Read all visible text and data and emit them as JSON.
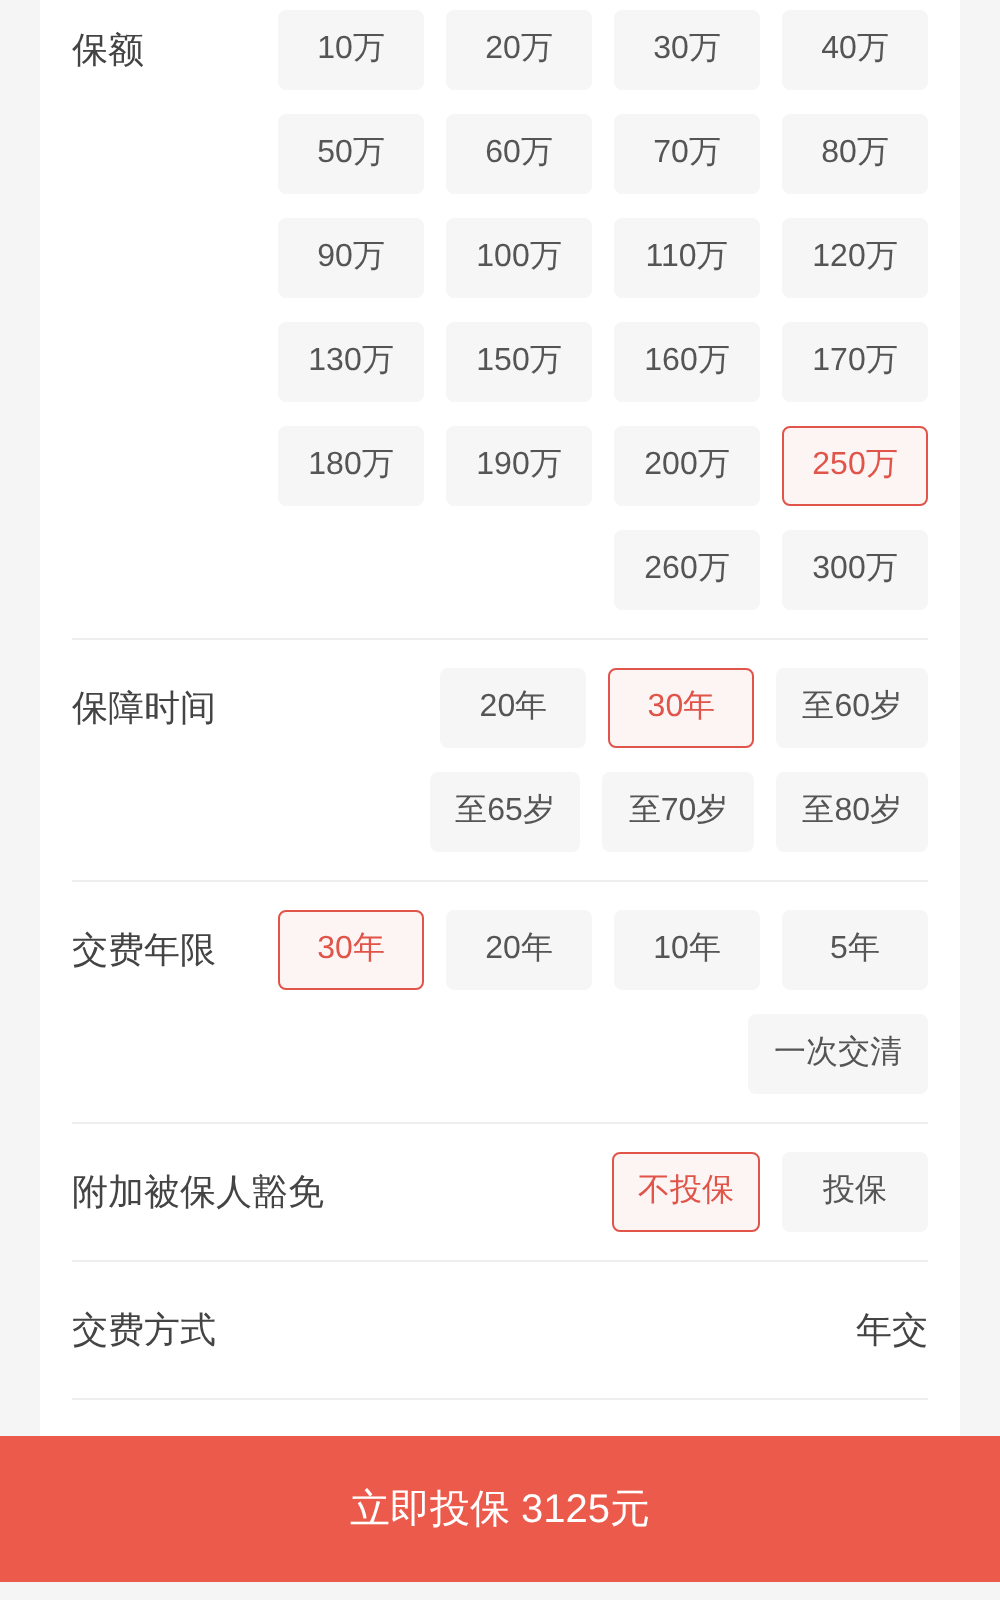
{
  "sections": [
    {
      "kind": "options",
      "label": "保额",
      "options": [
        {
          "label": "10万",
          "selected": false
        },
        {
          "label": "20万",
          "selected": false
        },
        {
          "label": "30万",
          "selected": false
        },
        {
          "label": "40万",
          "selected": false
        },
        {
          "label": "50万",
          "selected": false
        },
        {
          "label": "60万",
          "selected": false
        },
        {
          "label": "70万",
          "selected": false
        },
        {
          "label": "80万",
          "selected": false
        },
        {
          "label": "90万",
          "selected": false
        },
        {
          "label": "100万",
          "selected": false
        },
        {
          "label": "110万",
          "selected": false
        },
        {
          "label": "120万",
          "selected": false
        },
        {
          "label": "130万",
          "selected": false
        },
        {
          "label": "150万",
          "selected": false
        },
        {
          "label": "160万",
          "selected": false
        },
        {
          "label": "170万",
          "selected": false
        },
        {
          "label": "180万",
          "selected": false
        },
        {
          "label": "190万",
          "selected": false
        },
        {
          "label": "200万",
          "selected": false
        },
        {
          "label": "250万",
          "selected": true
        },
        {
          "label": "260万",
          "selected": false
        },
        {
          "label": "300万",
          "selected": false
        }
      ]
    },
    {
      "kind": "options",
      "label": "保障时间",
      "options": [
        {
          "label": "20年",
          "selected": false
        },
        {
          "label": "30年",
          "selected": true
        },
        {
          "label": "至60岁",
          "selected": false
        },
        {
          "label": "至65岁",
          "selected": false
        },
        {
          "label": "至70岁",
          "selected": false
        },
        {
          "label": "至80岁",
          "selected": false
        }
      ]
    },
    {
      "kind": "options",
      "label": "交费年限",
      "options": [
        {
          "label": "30年",
          "selected": true
        },
        {
          "label": "20年",
          "selected": false
        },
        {
          "label": "10年",
          "selected": false
        },
        {
          "label": "5年",
          "selected": false
        },
        {
          "label": "一次交清",
          "selected": false
        }
      ]
    },
    {
      "kind": "options",
      "label": "附加被保人豁免",
      "options": [
        {
          "label": "不投保",
          "selected": true
        },
        {
          "label": "投保",
          "selected": false
        }
      ]
    },
    {
      "kind": "value",
      "label": "交费方式",
      "value": "年交"
    }
  ],
  "submit_button": "立即投保 3125元"
}
